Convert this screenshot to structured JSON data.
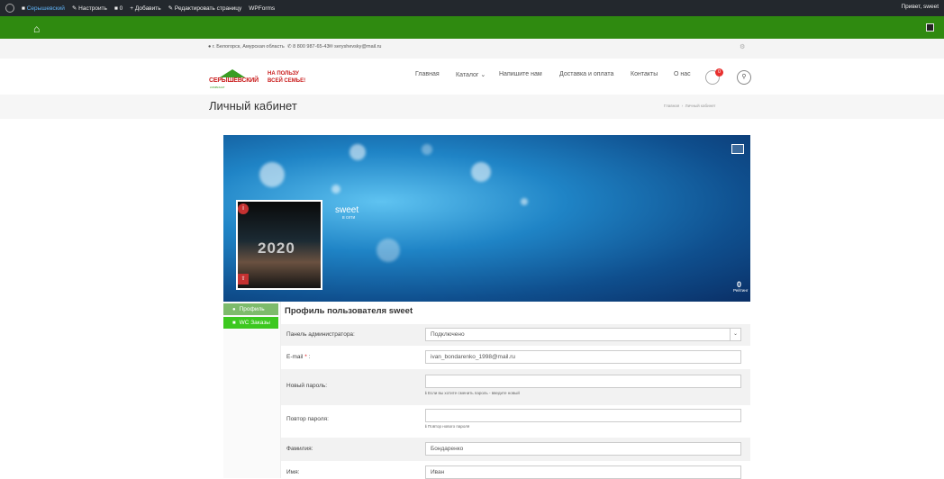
{
  "adminbar": {
    "site": "Серышевский",
    "customize": "Настроить",
    "comments": "0",
    "add": "Добавить",
    "edit": "Редактировать страницу",
    "wpforms": "WPForms",
    "greeting": "Привет, sweet"
  },
  "topinfo": {
    "address": "г. Белогорск, Амурская область",
    "phone": "8 800 987-65-43",
    "email": "seryshevsky@mail.ru"
  },
  "logo": {
    "name": "СЕРЫШЕВСКИЙ",
    "sub": "КОМБИНАТ",
    "slogan_1": "НА ПОЛЬЗУ",
    "slogan_2": "ВСЕЙ СЕМЬЕ!"
  },
  "nav": {
    "items": [
      "Главная",
      "Каталог",
      "Напишите нам",
      "Доставка и оплата",
      "Контакты",
      "О нас"
    ],
    "cart_count": "0"
  },
  "page": {
    "title": "Личный кабинет",
    "breadcrumb_home": "Главная",
    "breadcrumb_current": "Личный кабинет"
  },
  "profile": {
    "username": "sweet",
    "status": "в сети",
    "avatar_text": "2020",
    "rating_value": "0",
    "rating_label": "Рейтинг"
  },
  "tabs": {
    "profile": "Профиль",
    "orders": "WC Заказы"
  },
  "form": {
    "heading": "Профиль пользователя sweet",
    "admin_panel_label": "Панель администратора:",
    "admin_panel_value": "Подключено",
    "email_label": "E-mail",
    "email_value": "ivan_bondarenko_1998@mail.ru",
    "new_password_label": "Новый пароль:",
    "new_password_hint": "Если вы хотите сменить пароль - введите новый",
    "repeat_password_label": "Повтор пароля:",
    "repeat_password_hint": "Повтор нового пароля",
    "lastname_label": "Фамилия:",
    "lastname_value": "Бондаренко",
    "firstname_label": "Имя:",
    "firstname_value": "Иван"
  }
}
